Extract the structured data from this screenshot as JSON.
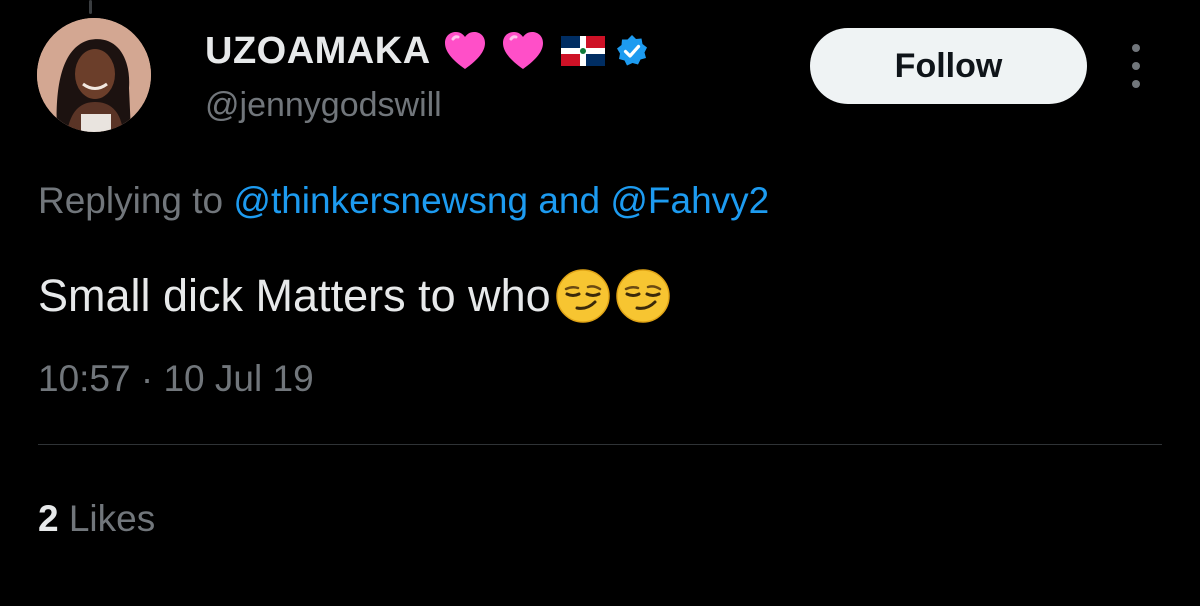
{
  "user": {
    "display_name": "UZOAMAKA",
    "handle": "@jennygodswill",
    "badges": [
      "heart-icon",
      "heart-icon",
      "dominican-flag-icon",
      "verified-badge-icon"
    ]
  },
  "actions": {
    "follow_label": "Follow",
    "more_icon": "more-vertical-icon"
  },
  "reply": {
    "prefix": "Replying to",
    "mention_1": "@thinkersnewsng",
    "conjunction": "and",
    "mention_2": "@Fahvy2"
  },
  "tweet": {
    "text": "Small dick Matters to who",
    "emojis": [
      "smirking-face-icon",
      "smirking-face-icon"
    ],
    "time": "10:57",
    "separator": "·",
    "date": "10 Jul 19"
  },
  "stats": {
    "likes_count": "2",
    "likes_label": "Likes"
  },
  "colors": {
    "background": "#000000",
    "primary_text": "#e7e9ea",
    "secondary_text": "#71767b",
    "link": "#1d9bf0",
    "button_bg": "#eff3f4",
    "verified": "#1d9bf0",
    "heart": "#ff4fc8"
  }
}
